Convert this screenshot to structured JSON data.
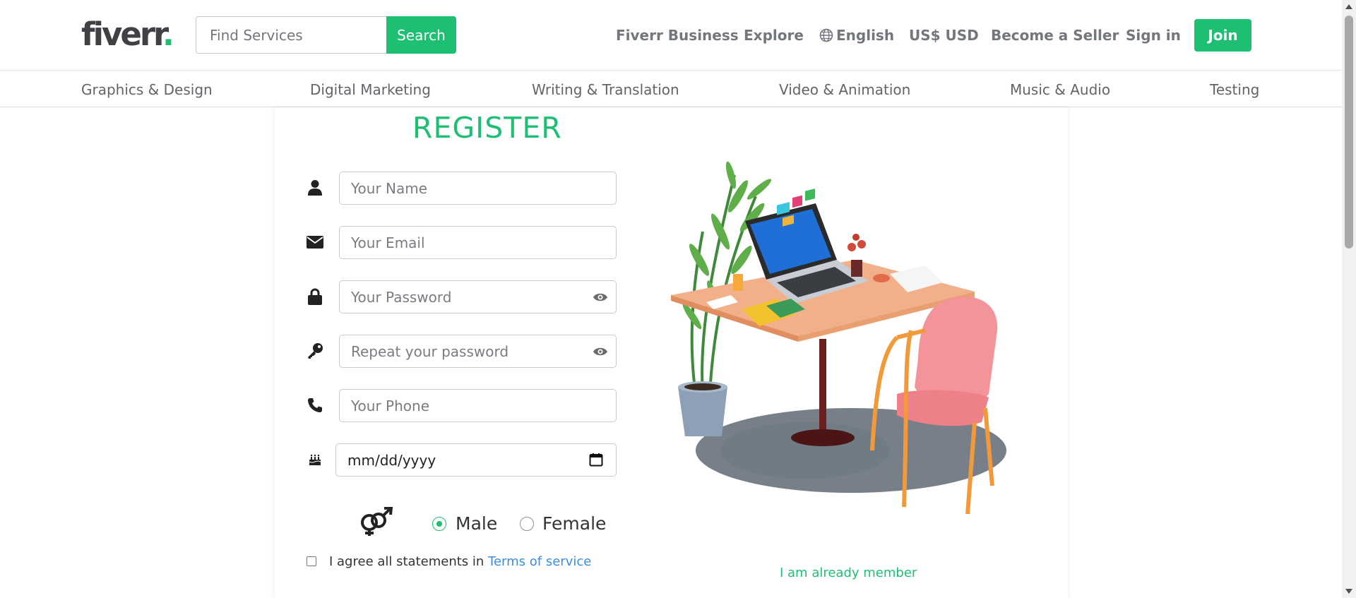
{
  "header": {
    "logo_text": "fiverr",
    "logo_dot": ".",
    "search_placeholder": "Find Services",
    "search_button": "Search",
    "nav": {
      "business": "Fiverr Business",
      "explore": "Explore",
      "language": "English",
      "currency": "US$ USD",
      "seller": "Become a Seller",
      "signin": "Sign in"
    },
    "join_button": "Join",
    "brand_color": "#1dbf73",
    "business_color": "#4a2b9c"
  },
  "categories": [
    "Graphics & Design",
    "Digital Marketing",
    "Writing & Translation",
    "Video & Animation",
    "Music & Audio",
    "Testing"
  ],
  "form": {
    "title": "REGISTER",
    "name_placeholder": "Your Name",
    "email_placeholder": "Your Email",
    "password_placeholder": "Your Password",
    "repeat_password_placeholder": "Repeat your password",
    "phone_placeholder": "Your Phone",
    "date_placeholder": "mm/dd/yyyy",
    "gender_options": [
      "Male",
      "Female"
    ],
    "gender_selected": "Male",
    "agree_text": "I agree all statements in ",
    "terms_link": "Terms of service",
    "member_link": "I am already member"
  },
  "icons": {
    "name": "user-icon",
    "email": "envelope-icon",
    "password": "lock-icon",
    "repeat_password": "key-icon",
    "phone": "phone-icon",
    "birthday": "birthday-cake-icon",
    "gender": "venus-mars-icon",
    "visibility": "eye-icon",
    "calendar": "calendar-icon",
    "language": "globe-icon"
  }
}
